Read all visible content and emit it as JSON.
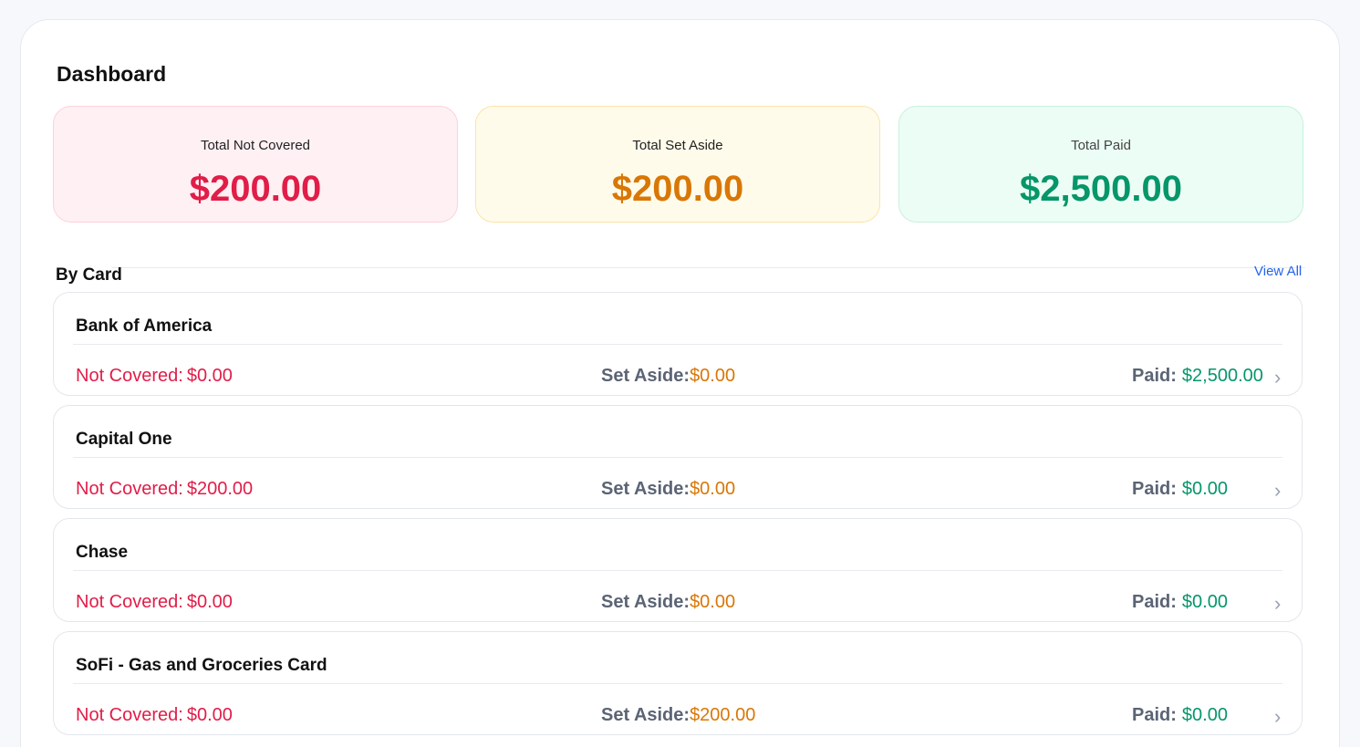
{
  "header": {
    "title": "Dashboard"
  },
  "summary": {
    "not_covered": {
      "label": "Total Not Covered",
      "value": "$200.00",
      "color": "#e11d48"
    },
    "set_aside": {
      "label": "Total Set Aside",
      "value": "$200.00",
      "color": "#d97706"
    },
    "paid": {
      "label": "Total Paid",
      "value": "$2,500.00",
      "color": "#059669"
    }
  },
  "by_card": {
    "title": "By Card",
    "view_all": "View All",
    "labels": {
      "not_covered": "Not Covered:",
      "set_aside": "Set Aside:",
      "paid": "Paid:"
    },
    "chevron": "›",
    "cards": [
      {
        "name": "Bank of America",
        "not_covered": "$0.00",
        "set_aside": "$0.00",
        "paid": "$2,500.00"
      },
      {
        "name": "Capital One",
        "not_covered": "$200.00",
        "set_aside": "$0.00",
        "paid": "$0.00"
      },
      {
        "name": "Chase",
        "not_covered": "$0.00",
        "set_aside": "$0.00",
        "paid": "$0.00"
      },
      {
        "name": "SoFi - Gas and Groceries Card",
        "not_covered": "$0.00",
        "set_aside": "$200.00",
        "paid": "$0.00"
      }
    ]
  }
}
